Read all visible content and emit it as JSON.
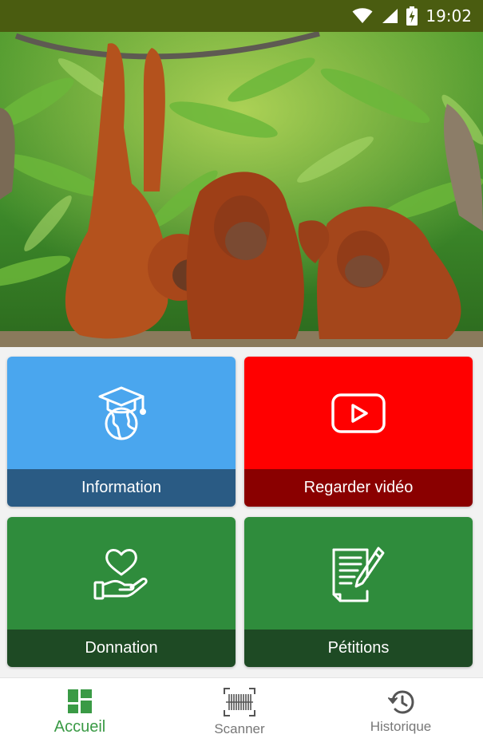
{
  "status_bar": {
    "time": "19:02",
    "icons": [
      "wifi-icon",
      "cell-signal-icon",
      "battery-charging-icon"
    ]
  },
  "hero": {
    "subject": "orangutans-photo"
  },
  "tiles": [
    {
      "label": "Information",
      "icon": "education-globe-icon",
      "top_color": "#4aa6ee",
      "label_color": "#2a5b84"
    },
    {
      "label": "Regarder vidéo",
      "icon": "youtube-play-icon",
      "top_color": "#ff0000",
      "label_color": "#8a0000"
    },
    {
      "label": "Donnation",
      "icon": "heart-in-hand-icon",
      "top_color": "#2f8c3c",
      "label_color": "#1e4a24"
    },
    {
      "label": "Pétitions",
      "icon": "document-pen-icon",
      "top_color": "#2f8c3c",
      "label_color": "#1e4a24"
    }
  ],
  "bottom_nav": {
    "items": [
      {
        "label": "Accueil",
        "icon": "home-grid-icon",
        "active": true
      },
      {
        "label": "Scanner",
        "icon": "barcode-scanner-icon",
        "active": false
      },
      {
        "label": "Historique",
        "icon": "history-icon",
        "active": false
      }
    ],
    "active_color": "#3a9a45"
  }
}
